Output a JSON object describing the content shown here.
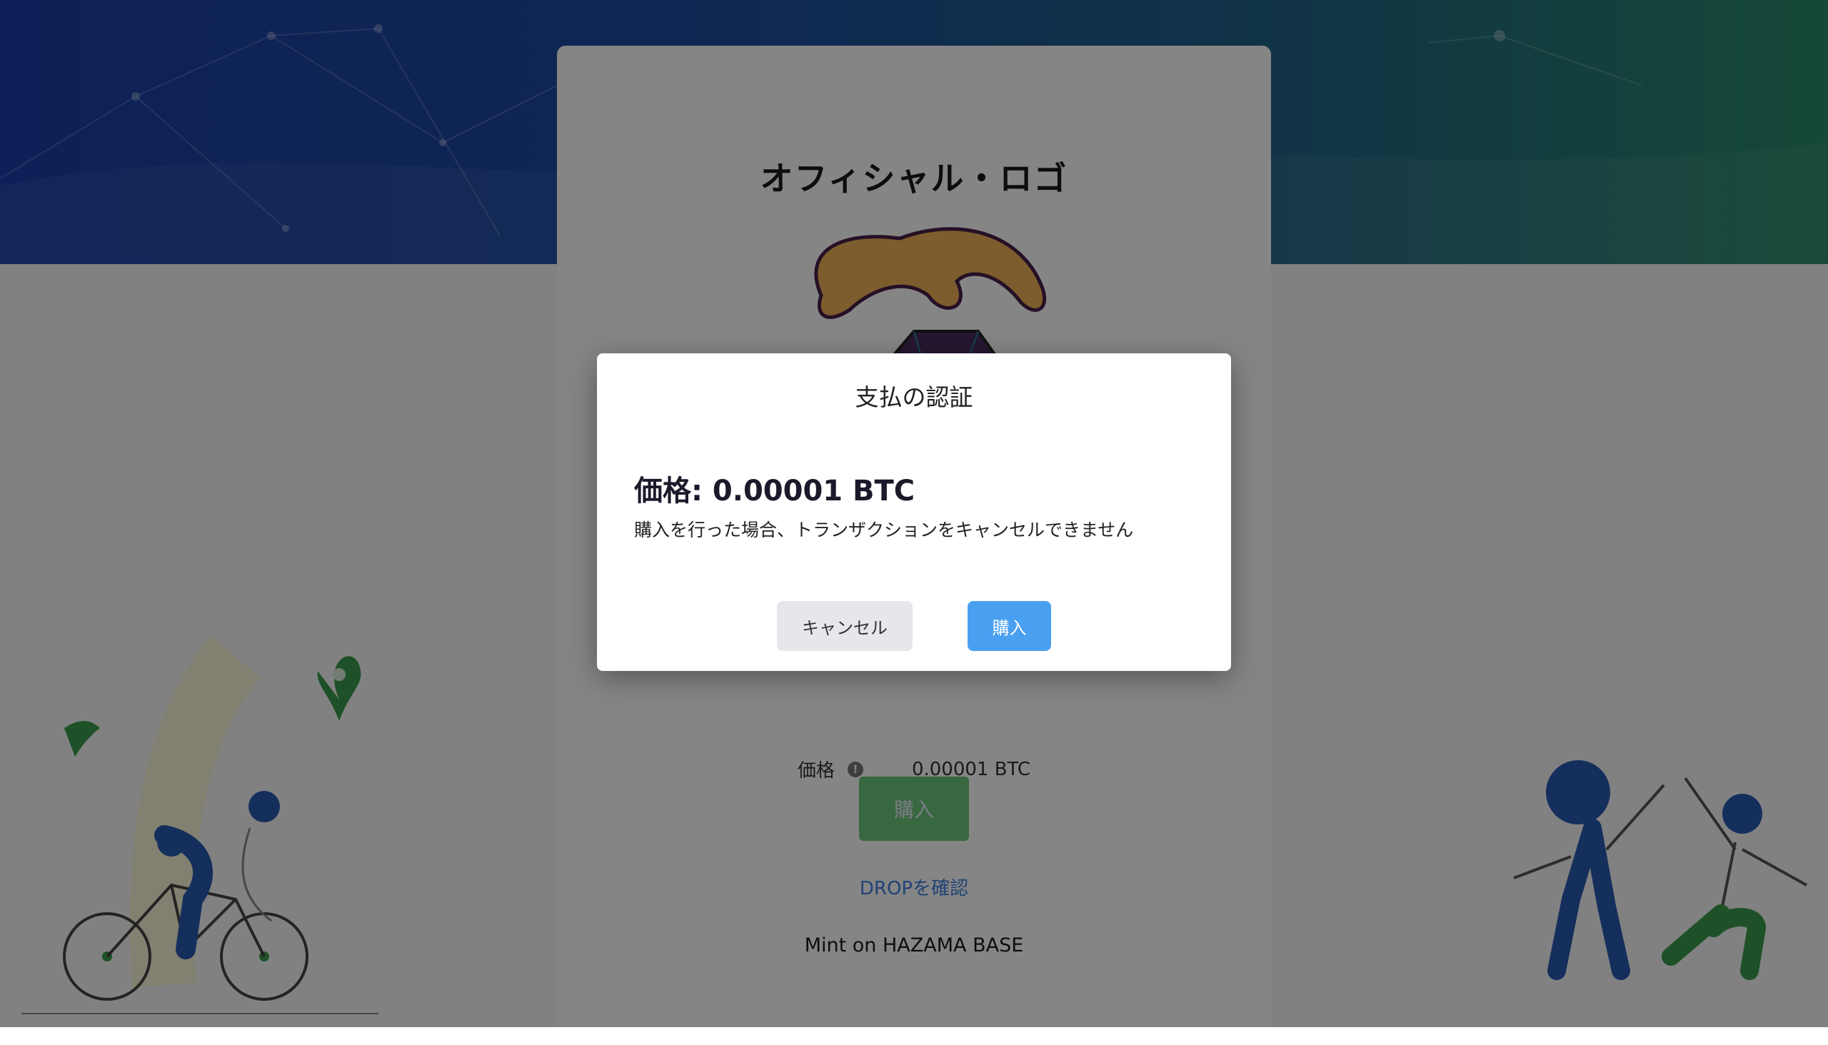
{
  "card": {
    "title": "オフィシャル・ロゴ",
    "price_label": "価格",
    "info_icon": "info-icon",
    "price_value": "0.00001 BTC",
    "buy_label": "購入",
    "drop_link": "DROPを確認",
    "mint_text": "Mint on HAZAMA BASE"
  },
  "modal": {
    "title": "支払の認証",
    "price": "価格: 0.00001 BTC",
    "note": "購入を行った場合、トランザクションをキャンセルできません",
    "cancel_label": "キャンセル",
    "buy_label": "購入"
  },
  "colors": {
    "primary_button": "#4aa0f0",
    "page_buy_button": "#6cc77a",
    "link": "#3f7fe0"
  }
}
